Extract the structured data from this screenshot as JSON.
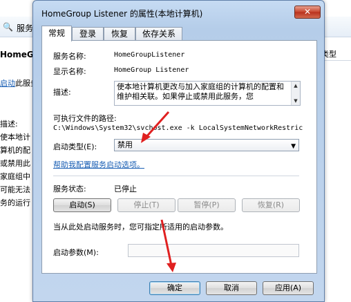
{
  "background": {
    "toolbar_label": "服务",
    "left_title": "HomeGr",
    "left_link": "启动",
    "left_link_suffix": "此服务",
    "left_lines": [
      "描述:",
      "使本地计",
      "算机的配",
      "或禁用此",
      "家庭组中",
      "可能无法",
      "务的运行"
    ],
    "column_header": "类型"
  },
  "dialog": {
    "title": "HomeGroup Listener 的属性(本地计算机)",
    "close_glyph": "✕",
    "tabs": [
      "常规",
      "登录",
      "恢复",
      "依存关系"
    ],
    "fields": {
      "service_name_label": "服务名称:",
      "service_name_value": "HomeGroupListener",
      "display_name_label": "显示名称:",
      "display_name_value": "HomeGroup Listener",
      "description_label": "描述:",
      "description_value": "使本地计算机更改与加入家庭组的计算机的配置和维护相关联。如果停止或禁用此服务，您",
      "exe_path_label": "可执行文件的路径:",
      "exe_path_value": "C:\\Windows\\System32\\svchost.exe -k LocalSystemNetworkRestric",
      "startup_type_label": "启动类型(E):",
      "startup_type_value": "禁用",
      "help_link": "帮助我配置服务启动选项。",
      "status_label": "服务状态:",
      "status_value": "已停止",
      "start_params_hint": "当从此处启动服务时，您可指定所适用的启动参数。",
      "start_params_label": "启动参数(M):",
      "start_params_value": ""
    },
    "service_buttons": {
      "start": "启动(S)",
      "stop": "停止(T)",
      "pause": "暂停(P)",
      "resume": "恢复(R)"
    },
    "footer_buttons": {
      "ok": "确定",
      "cancel": "取消",
      "apply": "应用(A)"
    }
  },
  "annotation_color": "#e02020"
}
